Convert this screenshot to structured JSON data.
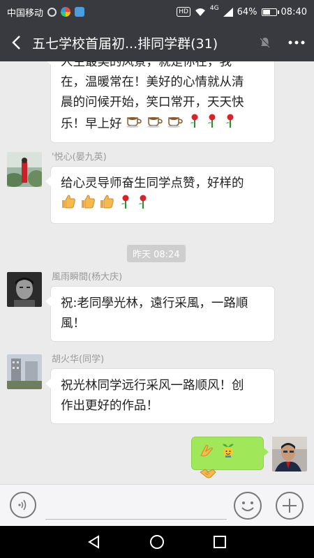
{
  "status_bar": {
    "carrier": "中国移动",
    "hd": "HD",
    "network": "4G",
    "battery": "64%",
    "battery_level": 0.64,
    "time": "08:40"
  },
  "title_bar": {
    "title": "五七学校首届初...排同学群(31)"
  },
  "messages": [
    {
      "sender": "",
      "lines": [
        "人生最美的风景，就是你在，我",
        "在，温暖常在！美好的心情就从清",
        "晨的问候开始，笑口常开，天天快",
        "乐！早上好"
      ],
      "emojis": [
        "coffee-icon",
        "coffee-icon",
        "coffee-icon",
        "rose-icon",
        "rose-icon",
        "rose-icon"
      ]
    },
    {
      "sender": "'悦心(晏九英)",
      "lines": [
        "给心灵导师奋生同学点赞，好样的"
      ],
      "emojis": [
        "thumbs-up-icon",
        "thumbs-up-icon",
        "thumbs-up-icon",
        "rose-icon",
        "rose-icon"
      ]
    },
    {
      "sender": "風雨瞬間(杨大庆)",
      "lines": [
        "祝:老同學光林，遠行采風，一路順",
        "風！"
      ]
    },
    {
      "sender": "胡火华(同学)",
      "lines": [
        "祝光林同学远行采风一路顺风！创",
        "作出更好的作品！"
      ]
    },
    {
      "sender": "",
      "emojis": [
        "clap-icon",
        "sprout-smile-icon",
        "handshake-icon"
      ]
    }
  ],
  "timestamp": "昨天 08:24",
  "input": {
    "value": "",
    "placeholder": ""
  },
  "colors": {
    "header_bg": "#393a3f",
    "chat_bg": "#ebebeb",
    "self_bubble": "#a0e75a"
  }
}
